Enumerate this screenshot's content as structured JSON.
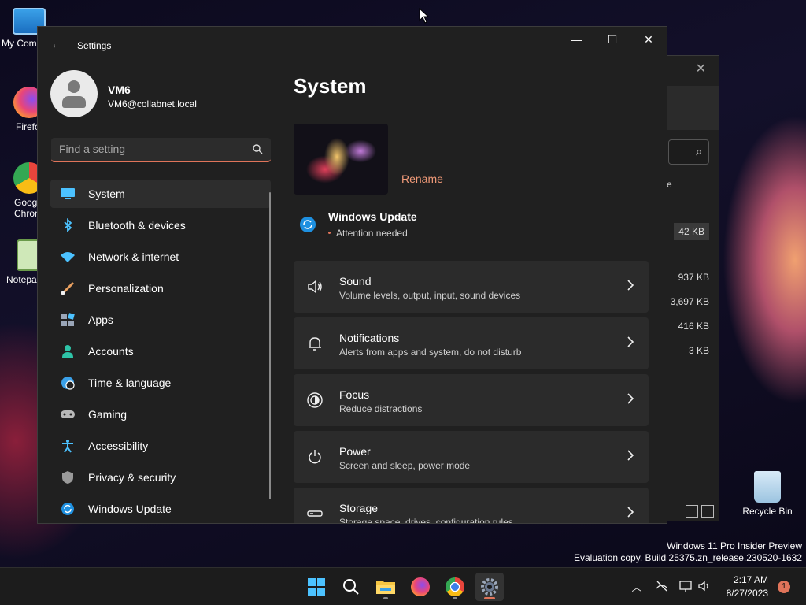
{
  "desktop": {
    "icons": [
      {
        "label": "My Com"
      },
      {
        "label": "Firefo"
      },
      {
        "label": "Goog\nChron"
      },
      {
        "label": "Notepa"
      }
    ],
    "recycle_bin": "Recycle Bin",
    "watermark_line1": "Windows 11 Pro Insider Preview",
    "watermark_line2": "Evaluation copy. Build 25375.zn_release.230520-1632"
  },
  "background_window": {
    "sizes": [
      "42 KB",
      "937 KB",
      "3,697 KB",
      "416 KB",
      "3 KB"
    ],
    "partial_label": "e"
  },
  "settings": {
    "app_title": "Settings",
    "user": {
      "name": "VM6",
      "email": "VM6@collabnet.local"
    },
    "search": {
      "placeholder": "Find a setting"
    },
    "nav": [
      {
        "label": "System",
        "icon": "system-icon",
        "active": true
      },
      {
        "label": "Bluetooth & devices",
        "icon": "bluetooth-icon"
      },
      {
        "label": "Network & internet",
        "icon": "wifi-icon"
      },
      {
        "label": "Personalization",
        "icon": "brush-icon"
      },
      {
        "label": "Apps",
        "icon": "apps-icon"
      },
      {
        "label": "Accounts",
        "icon": "accounts-icon"
      },
      {
        "label": "Time & language",
        "icon": "globe-clock-icon"
      },
      {
        "label": "Gaming",
        "icon": "gamepad-icon"
      },
      {
        "label": "Accessibility",
        "icon": "accessibility-icon"
      },
      {
        "label": "Privacy & security",
        "icon": "shield-icon"
      },
      {
        "label": "Windows Update",
        "icon": "update-icon"
      }
    ],
    "page_title": "System",
    "rename_label": "Rename",
    "windows_update": {
      "title": "Windows Update",
      "status": "Attention needed"
    },
    "cards": [
      {
        "title": "Sound",
        "subtitle": "Volume levels, output, input, sound devices",
        "icon": "speaker-icon"
      },
      {
        "title": "Notifications",
        "subtitle": "Alerts from apps and system, do not disturb",
        "icon": "bell-icon"
      },
      {
        "title": "Focus",
        "subtitle": "Reduce distractions",
        "icon": "focus-icon"
      },
      {
        "title": "Power",
        "subtitle": "Screen and sleep, power mode",
        "icon": "power-icon"
      },
      {
        "title": "Storage",
        "subtitle": "Storage space, drives, configuration rules",
        "icon": "storage-icon"
      }
    ]
  },
  "taskbar": {
    "clock_time": "2:17 AM",
    "clock_date": "8/27/2023",
    "notification_count": "1"
  },
  "colors": {
    "accent": "#e0745a",
    "window_bg": "#202020",
    "card_bg": "#2b2b2b"
  }
}
